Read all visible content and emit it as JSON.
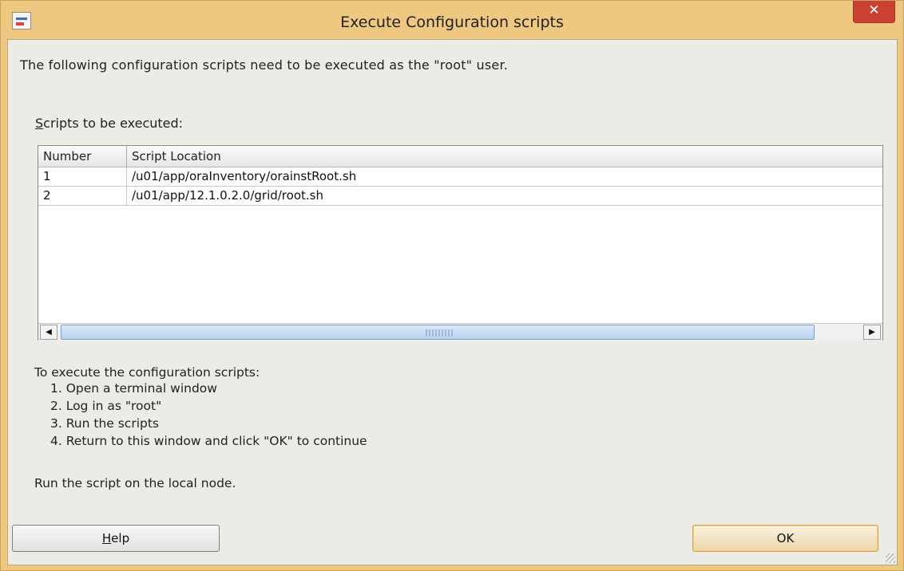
{
  "window": {
    "title": "Execute Configuration scripts",
    "close_label": "✕",
    "icon": "java-app-icon"
  },
  "dialog": {
    "intro_text": "The following configuration scripts need to be executed as the \"root\" user.",
    "scripts_label_mnemonic": "S",
    "scripts_label_rest": "cripts to be executed:",
    "table": {
      "columns": [
        "Number",
        "Script Location"
      ],
      "rows": [
        {
          "number": "1",
          "location": "/u01/app/oraInventory/orainstRoot.sh"
        },
        {
          "number": "2",
          "location": "/u01/app/12.1.0.2.0/grid/root.sh"
        }
      ]
    },
    "instructions_heading": "To execute the configuration scripts:",
    "steps": [
      "1. Open a terminal window",
      "2. Log in as \"root\"",
      "3. Run the scripts",
      "4. Return to this window and click \"OK\" to continue"
    ],
    "node_note": "Run the script on the local node.",
    "buttons": {
      "help_mnemonic": "H",
      "help_rest": "elp",
      "ok_label": "OK"
    }
  }
}
